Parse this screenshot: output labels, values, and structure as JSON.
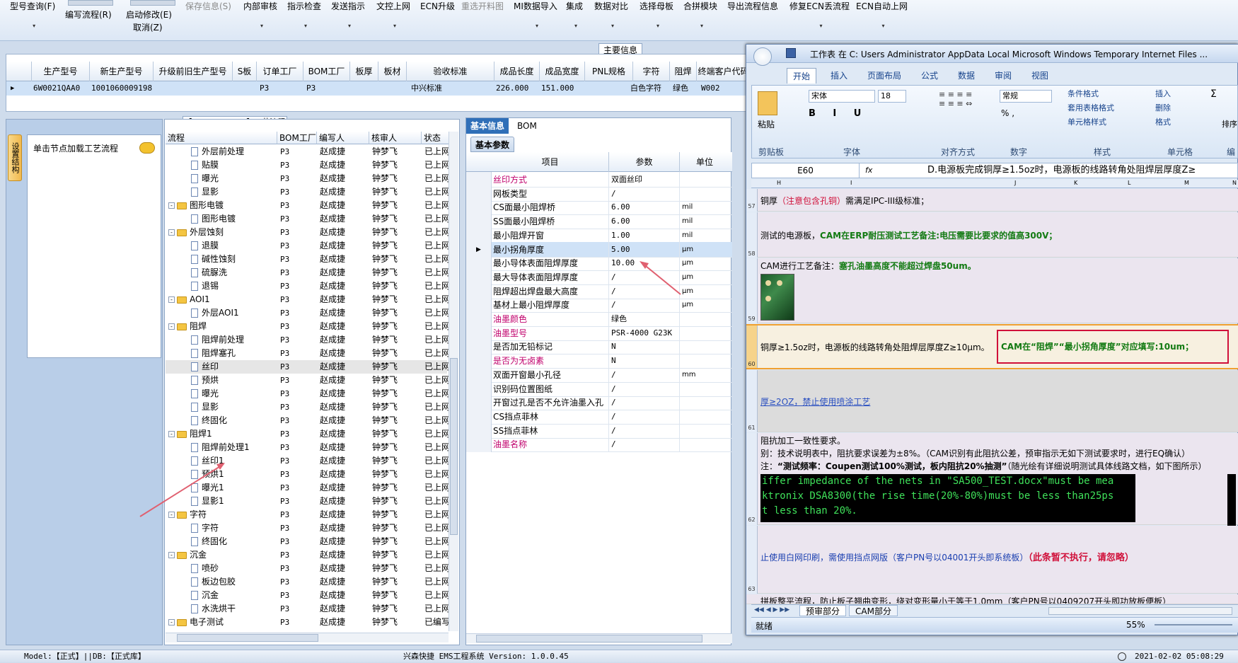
{
  "toolbar": {
    "items": [
      "型号查询(F)",
      "编写流程(R)",
      "启动修改(E)",
      "保存信息(S)",
      "内部审核",
      "指示检查",
      "发送指示",
      "文控上网",
      "ECN升级",
      "重选开料图",
      "MI数据导入",
      "集成",
      "数据对比",
      "选择母板",
      "合拼模块",
      "导出流程信息",
      "修复ECN丢流程",
      "ECN自动上网"
    ],
    "sub_cancel": "取消(Z)"
  },
  "main_info": {
    "title": "主要信息",
    "columns": [
      "生产型号",
      "新生产型号",
      "升级前旧生产型号",
      "S板",
      "订单工厂",
      "BOM工厂",
      "板厚",
      "板材",
      "验收标准",
      "成品长度",
      "成品宽度",
      "PNL规格",
      "字符",
      "阻焊",
      "终端客户代码"
    ],
    "row": [
      "6W0021QAA0",
      "1001060009198 9",
      "",
      "",
      "P3",
      "P3",
      "",
      "",
      "中兴标准",
      "226.000",
      "151.000",
      "",
      "白色字符",
      "绿色",
      "W002"
    ]
  },
  "left_nav": {
    "tab_label": "设置结构",
    "node_text": "单击节点加载工艺流程"
  },
  "tree": {
    "title": "【6W0021QAA0】工艺流程",
    "columns": [
      "流程",
      "BOM工厂",
      "编写人",
      "核审人",
      "状态"
    ],
    "rows": [
      {
        "t": "doc",
        "name": "外层前处理",
        "f": "P3",
        "w": "赵成捷",
        "r": "钟梦飞",
        "s": "已上网"
      },
      {
        "t": "doc",
        "name": "贴膜",
        "f": "P3",
        "w": "赵成捷",
        "r": "钟梦飞",
        "s": "已上网"
      },
      {
        "t": "doc",
        "name": "曝光",
        "f": "P3",
        "w": "赵成捷",
        "r": "钟梦飞",
        "s": "已上网"
      },
      {
        "t": "doc",
        "name": "显影",
        "f": "P3",
        "w": "赵成捷",
        "r": "钟梦飞",
        "s": "已上网"
      },
      {
        "t": "fold",
        "name": "图形电镀",
        "f": "P3",
        "w": "赵成捷",
        "r": "钟梦飞",
        "s": "已上网"
      },
      {
        "t": "doc",
        "name": "图形电镀",
        "f": "P3",
        "w": "赵成捷",
        "r": "钟梦飞",
        "s": "已上网"
      },
      {
        "t": "fold",
        "name": "外层蚀刻",
        "f": "P3",
        "w": "赵成捷",
        "r": "钟梦飞",
        "s": "已上网"
      },
      {
        "t": "doc",
        "name": "退膜",
        "f": "P3",
        "w": "赵成捷",
        "r": "钟梦飞",
        "s": "已上网"
      },
      {
        "t": "doc",
        "name": "碱性蚀刻",
        "f": "P3",
        "w": "赵成捷",
        "r": "钟梦飞",
        "s": "已上网"
      },
      {
        "t": "doc",
        "name": "硫脲洗",
        "f": "P3",
        "w": "赵成捷",
        "r": "钟梦飞",
        "s": "已上网"
      },
      {
        "t": "doc",
        "name": "退锡",
        "f": "P3",
        "w": "赵成捷",
        "r": "钟梦飞",
        "s": "已上网"
      },
      {
        "t": "fold",
        "name": "AOI1",
        "f": "P3",
        "w": "赵成捷",
        "r": "钟梦飞",
        "s": "已上网"
      },
      {
        "t": "doc",
        "name": "外层AOI1",
        "f": "P3",
        "w": "赵成捷",
        "r": "钟梦飞",
        "s": "已上网"
      },
      {
        "t": "fold",
        "name": "阻焊",
        "f": "P3",
        "w": "赵成捷",
        "r": "钟梦飞",
        "s": "已上网"
      },
      {
        "t": "doc",
        "name": "阻焊前处理",
        "f": "P3",
        "w": "赵成捷",
        "r": "钟梦飞",
        "s": "已上网"
      },
      {
        "t": "doc",
        "name": "阻焊塞孔",
        "f": "P3",
        "w": "赵成捷",
        "r": "钟梦飞",
        "s": "已上网"
      },
      {
        "t": "doc",
        "name": "丝印",
        "f": "P3",
        "w": "赵成捷",
        "r": "钟梦飞",
        "s": "已上网",
        "sel": true
      },
      {
        "t": "doc",
        "name": "预烘",
        "f": "P3",
        "w": "赵成捷",
        "r": "钟梦飞",
        "s": "已上网"
      },
      {
        "t": "doc",
        "name": "曝光",
        "f": "P3",
        "w": "赵成捷",
        "r": "钟梦飞",
        "s": "已上网"
      },
      {
        "t": "doc",
        "name": "显影",
        "f": "P3",
        "w": "赵成捷",
        "r": "钟梦飞",
        "s": "已上网"
      },
      {
        "t": "doc",
        "name": "终固化",
        "f": "P3",
        "w": "赵成捷",
        "r": "钟梦飞",
        "s": "已上网"
      },
      {
        "t": "fold",
        "name": "阻焊1",
        "f": "P3",
        "w": "赵成捷",
        "r": "钟梦飞",
        "s": "已上网"
      },
      {
        "t": "doc",
        "name": "阻焊前处理1",
        "f": "P3",
        "w": "赵成捷",
        "r": "钟梦飞",
        "s": "已上网"
      },
      {
        "t": "doc",
        "name": "丝印1",
        "f": "P3",
        "w": "赵成捷",
        "r": "钟梦飞",
        "s": "已上网"
      },
      {
        "t": "doc",
        "name": "预烘1",
        "f": "P3",
        "w": "赵成捷",
        "r": "钟梦飞",
        "s": "已上网"
      },
      {
        "t": "doc",
        "name": "曝光1",
        "f": "P3",
        "w": "赵成捷",
        "r": "钟梦飞",
        "s": "已上网"
      },
      {
        "t": "doc",
        "name": "显影1",
        "f": "P3",
        "w": "赵成捷",
        "r": "钟梦飞",
        "s": "已上网"
      },
      {
        "t": "fold",
        "name": "字符",
        "f": "P3",
        "w": "赵成捷",
        "r": "钟梦飞",
        "s": "已上网"
      },
      {
        "t": "doc",
        "name": "字符",
        "f": "P3",
        "w": "赵成捷",
        "r": "钟梦飞",
        "s": "已上网"
      },
      {
        "t": "doc",
        "name": "终固化",
        "f": "P3",
        "w": "赵成捷",
        "r": "钟梦飞",
        "s": "已上网"
      },
      {
        "t": "fold",
        "name": "沉金",
        "f": "P3",
        "w": "赵成捷",
        "r": "钟梦飞",
        "s": "已上网"
      },
      {
        "t": "doc",
        "name": "喷砂",
        "f": "P3",
        "w": "赵成捷",
        "r": "钟梦飞",
        "s": "已上网"
      },
      {
        "t": "doc",
        "name": "板边包胶",
        "f": "P3",
        "w": "赵成捷",
        "r": "钟梦飞",
        "s": "已上网"
      },
      {
        "t": "doc",
        "name": "沉金",
        "f": "P3",
        "w": "赵成捷",
        "r": "钟梦飞",
        "s": "已上网"
      },
      {
        "t": "doc",
        "name": "水洗烘干",
        "f": "P3",
        "w": "赵成捷",
        "r": "钟梦飞",
        "s": "已上网"
      },
      {
        "t": "fold",
        "name": "电子测试",
        "f": "P3",
        "w": "赵成捷",
        "r": "钟梦飞",
        "s": "已编写"
      }
    ]
  },
  "basic": {
    "tabs": [
      "基本信息",
      "BOM"
    ],
    "sub_tab": "基本参数",
    "columns": [
      "项目",
      "参数",
      "单位"
    ],
    "rows": [
      {
        "n": "丝印方式",
        "v": "双面丝印",
        "u": "",
        "red": true
      },
      {
        "n": "网板类型",
        "v": "/",
        "u": ""
      },
      {
        "n": "CS面最小阻焊桥",
        "v": "6.00",
        "u": "mil"
      },
      {
        "n": "SS面最小阻焊桥",
        "v": "6.00",
        "u": "mil"
      },
      {
        "n": "最小阻焊开窗",
        "v": "1.00",
        "u": "mil"
      },
      {
        "n": "最小拐角厚度",
        "v": "5.00",
        "u": "μm",
        "sel": true
      },
      {
        "n": "最小导体表面阻焊厚度",
        "v": "10.00",
        "u": "μm"
      },
      {
        "n": "最大导体表面阻焊厚度",
        "v": "/",
        "u": "μm"
      },
      {
        "n": "阻焊超出焊盘最大高度",
        "v": "/",
        "u": "μm"
      },
      {
        "n": "基材上最小阻焊厚度",
        "v": "/",
        "u": "μm"
      },
      {
        "n": "油墨颜色",
        "v": "绿色",
        "u": "",
        "red": true
      },
      {
        "n": "油墨型号",
        "v": "PSR-4000 G23K",
        "u": "",
        "red": true
      },
      {
        "n": "是否加无铅标记",
        "v": "N",
        "u": ""
      },
      {
        "n": "是否为无卤素",
        "v": "N",
        "u": "",
        "red": true
      },
      {
        "n": "双面开窗最小孔径",
        "v": "/",
        "u": "mm"
      },
      {
        "n": "识别码位置图纸",
        "v": "/",
        "u": ""
      },
      {
        "n": "开窗过孔是否不允许油墨入孔",
        "v": "/",
        "u": ""
      },
      {
        "n": "CS挡点菲林",
        "v": "/",
        "u": ""
      },
      {
        "n": "SS挡点菲林",
        "v": "/",
        "u": ""
      },
      {
        "n": "油墨名称",
        "v": "/",
        "u": "",
        "red": true
      }
    ]
  },
  "excel": {
    "title": "工作表 在 C: Users Administrator AppData Local Microsoft Windows Temporary Internet Files ...",
    "tabs": [
      "开始",
      "插入",
      "页面布局",
      "公式",
      "数据",
      "审阅",
      "视图"
    ],
    "font_name": "宋体",
    "font_size": "18",
    "number_format": "常规",
    "groups": [
      "剪贴板",
      "字体",
      "对齐方式",
      "数字",
      "样式",
      "单元格",
      "编"
    ],
    "style_buttons": [
      "条件格式",
      "套用表格格式",
      "单元格样式"
    ],
    "cell_buttons": [
      "插入",
      "删除",
      "格式"
    ],
    "paste_label": "粘贴",
    "sort_label": "排序",
    "cell_ref": "E60",
    "formula": "D.电源板完成铜厚≥1.5oz时，电源板的线路转角处阻焊层厚度Z≥",
    "fx": "fx",
    "rows": {
      "r57": "铜厚（注意包含孔铜）需满足IPC-III级标准；",
      "r57_red": "（注意包含孔铜）",
      "r58_a": "测试的电源板，",
      "r58_b": "CAM在ERP耐压测试工艺备注:电压需要比要求的值高300V；",
      "r59_a": "CAM进行工艺备注：",
      "r59_b": "塞孔油墨高度不能超过焊盘50um。",
      "r60_a": "铜厚≥1.5oz时，电源板的线路转角处阻焊层厚度Z≥10μm。",
      "r60_b": "CAM在“阻焊”“最小拐角厚度”对应填写:10um；",
      "r61": "厚≥2OZ，禁止使用喷涂工艺",
      "r62_1": "阻抗加工一致性要求。",
      "r62_2": "别：技术说明表中，阻抗要求误差为±8%。（CAM识别有此阻抗公差，预审指示无如下测试要求时，进行EQ确认）",
      "r62_3a": "注：",
      "r62_3b": "“测试频率：Coupen测试100%测试，板内阻抗20%抽测”",
      "r62_3c": "（随光绘有详细说明测试具体线路文档，如下图所示）",
      "r62_img1": "iffer impedance of the nets in \"SA500_TEST.docx\"must be mea",
      "r62_img2": "ktronix DSA8300(the rise time(20%-80%)must be less than25ps",
      "r62_img3": "t less than 20%.",
      "r63_a": "止使用白网印刷，需使用挡点网版（客户PN号以04001开头即系统板）",
      "r63_b": "（此条暂不执行，请忽略）",
      "r64": "拼板整平流程，防止板子翘曲变形，绕对变形量小于等于1.0mm（客户PN号以0409207开头即功放板便板）"
    },
    "row_numbers": [
      "57",
      "58",
      "59",
      "60",
      "61",
      "62",
      "63"
    ],
    "columns": [
      "H",
      "I",
      "J",
      "K",
      "L",
      "M",
      "N"
    ],
    "sheet_tabs": [
      "预审部分",
      "CAM部分"
    ],
    "status_left": "就绪",
    "zoom": "55%"
  },
  "status": {
    "left": "Model:【正式】||DB:【正式库】",
    "center": "兴森快捷 EMS工程系统 Version: 1.0.0.45",
    "right": "2021-02-02 05:08:29"
  },
  "colors": {
    "accent": "#1f6fc7",
    "highlight_red": "#d0103a",
    "green_text": "#127a12"
  }
}
